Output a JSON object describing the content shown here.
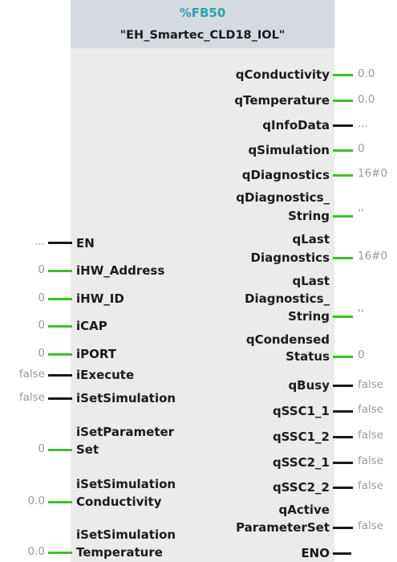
{
  "block": {
    "id": "%FB50",
    "name": "\"EH_Smartec_CLD18_IOL\""
  },
  "inputs": [
    {
      "label": "EN",
      "value": "..."
    },
    {
      "label": "iHW_Address",
      "value": "0"
    },
    {
      "label": "iHW_ID",
      "value": "0"
    },
    {
      "label": "iCAP",
      "value": "0"
    },
    {
      "label": "iPORT",
      "value": "0"
    },
    {
      "label": "iExecute",
      "value": "false"
    },
    {
      "label": "iSetSimulation",
      "value": "false"
    },
    {
      "label_line1": "iSetParameter",
      "label_line2": "Set",
      "value": "0"
    },
    {
      "label_line1": "iSetSimulation",
      "label_line2": "Conductivity",
      "value": "0.0"
    },
    {
      "label_line1": "iSetSimulation",
      "label_line2": "Temperature",
      "value": "0.0"
    }
  ],
  "outputs": [
    {
      "label": "qConductivity",
      "value": "0.0"
    },
    {
      "label": "qTemperature",
      "value": "0.0"
    },
    {
      "label": "qInfoData",
      "value": "..."
    },
    {
      "label": "qSimulation",
      "value": "0"
    },
    {
      "label": "qDiagnostics",
      "value": "16#0"
    },
    {
      "label_line1": "qDiagnostics_",
      "label_line2": "String",
      "value": "''"
    },
    {
      "label_line1": "qLast",
      "label_line2": "Diagnostics",
      "value": "16#0"
    },
    {
      "label_line1": "qLast",
      "label_line2": "Diagnostics_",
      "label_line3": "String",
      "value": "''"
    },
    {
      "label_line1": "qCondensed",
      "label_line2": "Status",
      "value": "0"
    },
    {
      "label": "qBusy",
      "value": "false"
    },
    {
      "label": "qSSC1_1",
      "value": "false"
    },
    {
      "label": "qSSC1_2",
      "value": "false"
    },
    {
      "label": "qSSC2_1",
      "value": "false"
    },
    {
      "label": "qSSC2_2",
      "value": "false"
    },
    {
      "label_line1": "qActive",
      "label_line2": "ParameterSet",
      "value": "false"
    },
    {
      "label": "ENO",
      "value": ""
    }
  ]
}
